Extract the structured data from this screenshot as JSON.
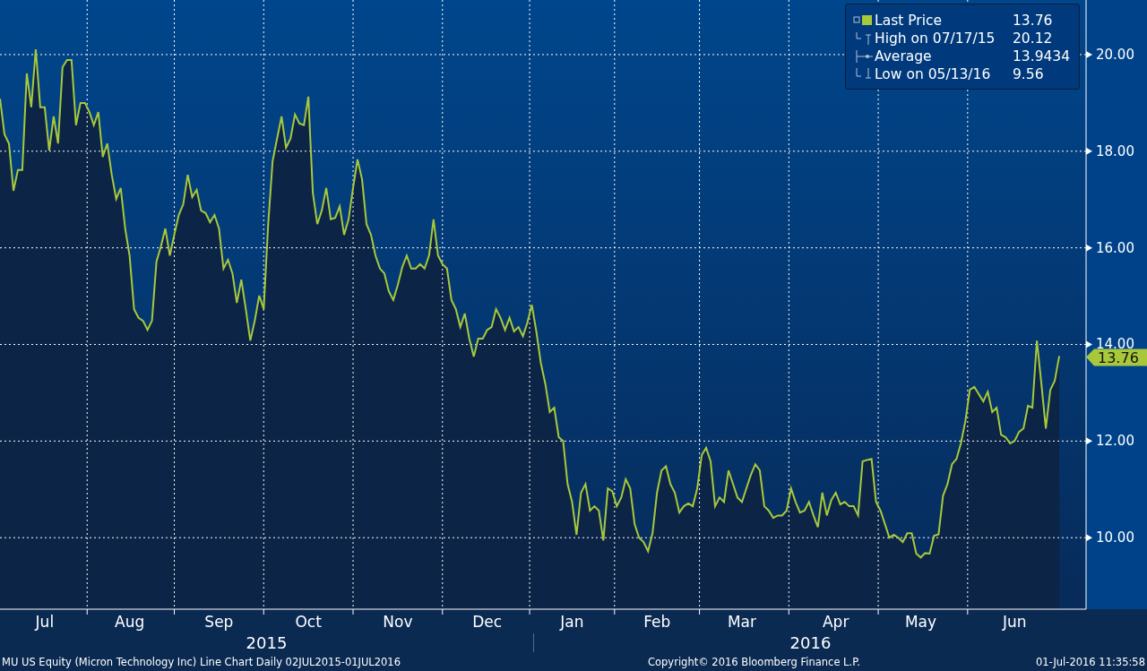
{
  "chart": {
    "chart_data": {
      "type": "line",
      "grid": true,
      "ylim": [
        8.52,
        21.13
      ],
      "categories": [
        null,
        null,
        null,
        null,
        null,
        null,
        null,
        null,
        null,
        null,
        "Jul",
        null,
        null,
        null,
        null,
        null,
        null,
        null,
        null,
        null,
        null,
        null,
        null,
        null,
        null,
        null,
        null,
        null,
        null,
        "Aug",
        null,
        null,
        null,
        null,
        null,
        null,
        null,
        null,
        null,
        null,
        null,
        null,
        null,
        null,
        null,
        null,
        null,
        null,
        null,
        "Sep",
        null,
        null,
        null,
        null,
        null,
        null,
        null,
        null,
        null,
        null,
        null,
        null,
        null,
        null,
        null,
        null,
        null,
        null,
        null,
        "Oct",
        null,
        null,
        null,
        null,
        null,
        null,
        null,
        null,
        null,
        null,
        null,
        null,
        null,
        null,
        null,
        null,
        null,
        null,
        null,
        "Nov",
        null,
        null,
        null,
        null,
        null,
        null,
        null,
        null,
        null,
        null,
        null,
        null,
        null,
        null,
        null,
        null,
        null,
        null,
        null,
        "Dec",
        null,
        null,
        null,
        null,
        null,
        null,
        null,
        null,
        null,
        null,
        null,
        null,
        null,
        null,
        null,
        null,
        null,
        null,
        "Jan",
        null,
        null,
        null,
        null,
        null,
        null,
        null,
        null,
        null,
        null,
        null,
        null,
        null,
        null,
        null,
        null,
        null,
        null,
        "Feb",
        null,
        null,
        null,
        null,
        null,
        null,
        null,
        null,
        null,
        null,
        null,
        null,
        null,
        null,
        null,
        null,
        null,
        null,
        "Mar",
        null,
        null,
        null,
        null,
        null,
        null,
        null,
        null,
        null,
        null,
        null,
        null,
        null,
        null,
        null,
        null,
        null,
        null,
        null,
        null,
        "Apr",
        null,
        null,
        null,
        null,
        null,
        null,
        null,
        null,
        null,
        null,
        null,
        null,
        null,
        null,
        null,
        null,
        null,
        null,
        "May",
        null,
        null,
        null,
        null,
        null,
        null,
        null,
        null,
        null,
        null,
        null,
        null,
        null,
        null,
        null,
        null,
        null,
        null,
        null,
        null,
        "Jun",
        null,
        null,
        null,
        null,
        null,
        null,
        null,
        null,
        null,
        null
      ],
      "yticks": [
        {
          "value": 10,
          "label": "10.00"
        },
        {
          "value": 12,
          "label": "12.00"
        },
        {
          "value": 14,
          "label": "14.00"
        },
        {
          "value": 16,
          "label": "16.00"
        },
        {
          "value": 18,
          "label": "18.00"
        },
        {
          "value": 20,
          "label": "20.00"
        }
      ],
      "series": [
        {
          "name": "Last Price",
          "color": "#a8c83c",
          "values": [
            19.09,
            18.35,
            18.16,
            17.18,
            17.61,
            17.61,
            19.61,
            18.91,
            20.11,
            18.91,
            18.91,
            18.01,
            18.72,
            18.16,
            19.74,
            19.89,
            19.89,
            18.54,
            19.0,
            19.0,
            18.81,
            18.54,
            18.81,
            17.88,
            18.16,
            17.51,
            17.01,
            17.24,
            16.4,
            15.84,
            14.73,
            14.55,
            14.49,
            14.3,
            14.49,
            15.71,
            16.03,
            16.4,
            15.84,
            16.27,
            16.68,
            16.9,
            17.51,
            17.05,
            17.2,
            16.77,
            16.72,
            16.53,
            16.68,
            16.4,
            15.57,
            15.75,
            15.47,
            14.86,
            15.34,
            14.73,
            14.08,
            14.49,
            15.01,
            14.73,
            16.49,
            17.79,
            18.26,
            18.72,
            18.07,
            18.26,
            18.76,
            18.57,
            18.54,
            19.13,
            17.14,
            16.49,
            16.77,
            17.24,
            16.59,
            16.62,
            16.86,
            16.27,
            16.59,
            17.24,
            17.83,
            17.42,
            16.49,
            16.27,
            15.84,
            15.57,
            15.47,
            15.1,
            14.92,
            15.23,
            15.6,
            15.84,
            15.57,
            15.57,
            15.66,
            15.57,
            15.84,
            16.59,
            15.84,
            15.66,
            15.57,
            14.92,
            14.73,
            14.36,
            14.64,
            14.12,
            13.75,
            14.12,
            14.12,
            14.3,
            14.36,
            14.73,
            14.55,
            14.3,
            14.55,
            14.27,
            14.36,
            14.17,
            14.45,
            14.82,
            14.27,
            13.62,
            13.19,
            12.6,
            12.69,
            12.08,
            12.0,
            11.11,
            10.74,
            10.06,
            10.93,
            11.11,
            10.56,
            10.65,
            10.56,
            9.94,
            11.02,
            10.96,
            10.65,
            10.83,
            11.21,
            11.02,
            10.28,
            10.0,
            9.91,
            9.72,
            10.09,
            10.93,
            11.39,
            11.48,
            11.11,
            10.93,
            10.52,
            10.65,
            10.71,
            10.65,
            11.02,
            11.71,
            11.86,
            11.58,
            10.65,
            10.83,
            10.74,
            11.39,
            11.11,
            10.83,
            10.74,
            11.02,
            11.3,
            11.52,
            11.39,
            10.65,
            10.56,
            10.41,
            10.46,
            10.46,
            10.56,
            11.02,
            10.74,
            10.52,
            10.56,
            10.74,
            10.46,
            10.22,
            10.93,
            10.46,
            10.78,
            10.93,
            10.69,
            10.74,
            10.65,
            10.65,
            10.46,
            11.58,
            11.61,
            11.63,
            10.74,
            10.56,
            10.28,
            10.0,
            10.06,
            10.0,
            9.91,
            10.09,
            10.09,
            9.67,
            9.59,
            9.68,
            9.67,
            10.04,
            10.07,
            10.87,
            11.11,
            11.52,
            11.63,
            11.95,
            12.41,
            13.06,
            13.12,
            12.97,
            12.82,
            13.02,
            12.6,
            12.69,
            12.13,
            12.08,
            11.95,
            12.0,
            12.19,
            12.26,
            12.73,
            12.69,
            14.08,
            13.19,
            12.26,
            13.06,
            13.25,
            13.76
          ]
        }
      ]
    },
    "price_tag": "13.76",
    "years": [
      "2015",
      "2016"
    ]
  },
  "legend": [
    {
      "kind": "series",
      "value": "13.76"
    },
    {
      "kind": "high",
      "label": "High on 07/17/15",
      "value": "20.12"
    },
    {
      "kind": "average",
      "label": "Average",
      "value": "13.9434"
    },
    {
      "kind": "low",
      "label": "Low on 05/13/16",
      "value": "9.56"
    }
  ],
  "footer": {
    "description": "MU US Equity (Micron Technology Inc) Line Chart  Daily 02JUL2015-01JUL2016",
    "copyright": "Copyright© 2016 Bloomberg Finance L.P.",
    "timestamp": "01-Jul-2016 11:35:58"
  }
}
